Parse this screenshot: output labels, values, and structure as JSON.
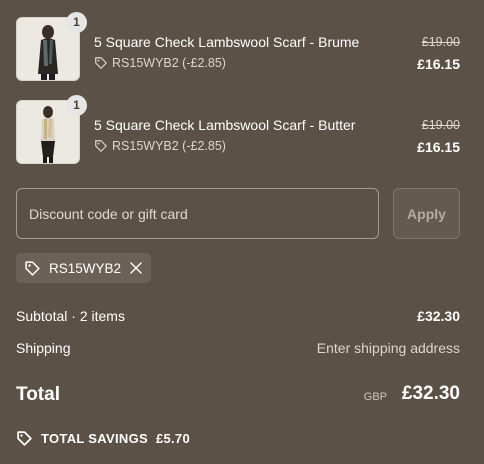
{
  "items": [
    {
      "quantity": "1",
      "title": "5 Square Check Lambswool Scarf - Brume",
      "discount": "RS15WYB2 (-£2.85)",
      "original_price": "£19.00",
      "price": "£16.15"
    },
    {
      "quantity": "1",
      "title": "5 Square Check Lambswool Scarf - Butter",
      "discount": "RS15WYB2 (-£2.85)",
      "original_price": "£19.00",
      "price": "£16.15"
    }
  ],
  "discount_form": {
    "placeholder": "Discount code or gift card",
    "value": "",
    "apply_label": "Apply"
  },
  "applied_code": "RS15WYB2",
  "summary": {
    "subtotal_label": "Subtotal · 2 items",
    "subtotal_value": "£32.30",
    "shipping_label": "Shipping",
    "shipping_value": "Enter shipping address",
    "total_label": "Total",
    "currency": "GBP",
    "total_value": "£32.30"
  },
  "savings": {
    "label": "TOTAL SAVINGS",
    "value": "£5.70"
  },
  "icons": {
    "tag": "tag-icon",
    "remove": "close-icon"
  },
  "colors": {
    "background": "#5c5146",
    "text": "#ffffff",
    "muted": "#ddd6cc"
  }
}
